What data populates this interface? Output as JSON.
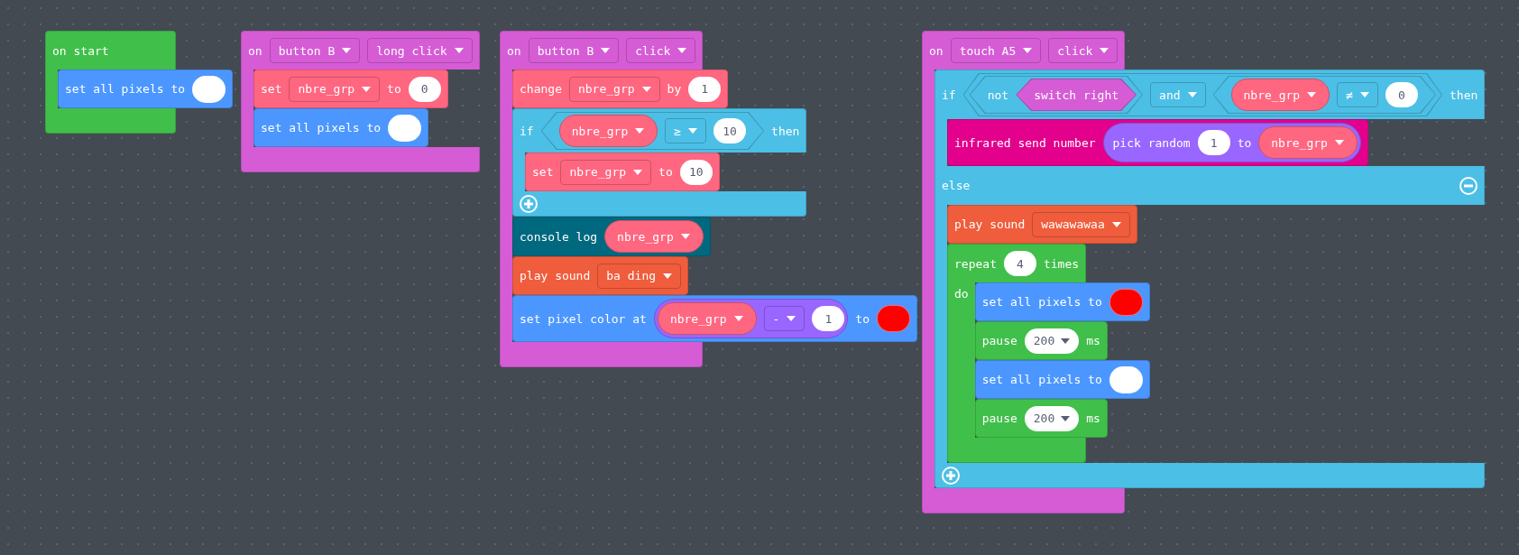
{
  "workspace": {
    "stacks": [
      {
        "kind": "hat",
        "color": "#40bf4a",
        "sections": [
          {
            "row": [
              {
                "kind": "label",
                "text": "on start"
              }
            ],
            "body": [
              {
                "kind": "statement",
                "color": "#4c97ff",
                "row": [
                  {
                    "kind": "label",
                    "text": "set all pixels to"
                  },
                  {
                    "kind": "color",
                    "color": "#ffffff"
                  }
                ]
              }
            ]
          }
        ]
      },
      {
        "kind": "hat",
        "color": "#d65cd6",
        "sections": [
          {
            "row": [
              {
                "kind": "label",
                "text": "on"
              },
              {
                "kind": "dropdown",
                "text": "button B"
              },
              {
                "kind": "dropdown",
                "text": "long click"
              }
            ],
            "body": [
              {
                "kind": "statement",
                "color": "#ff6680",
                "row": [
                  {
                    "kind": "label",
                    "text": "set"
                  },
                  {
                    "kind": "dropdown",
                    "text": "nbre_grp"
                  },
                  {
                    "kind": "label",
                    "text": "to"
                  },
                  {
                    "kind": "number",
                    "text": "0"
                  }
                ]
              },
              {
                "kind": "statement",
                "color": "#4c97ff",
                "row": [
                  {
                    "kind": "label",
                    "text": "set all pixels to"
                  },
                  {
                    "kind": "color",
                    "color": "#ffffff"
                  }
                ]
              }
            ]
          }
        ]
      },
      {
        "kind": "hat",
        "color": "#d65cd6",
        "sections": [
          {
            "row": [
              {
                "kind": "label",
                "text": "on"
              },
              {
                "kind": "dropdown",
                "text": "button B"
              },
              {
                "kind": "dropdown",
                "text": "click"
              }
            ],
            "body": [
              {
                "kind": "statement",
                "color": "#ff6680",
                "row": [
                  {
                    "kind": "label",
                    "text": "change"
                  },
                  {
                    "kind": "dropdown",
                    "text": "nbre_grp"
                  },
                  {
                    "kind": "label",
                    "text": "by"
                  },
                  {
                    "kind": "number",
                    "text": "1"
                  }
                ]
              },
              {
                "kind": "if",
                "color": "#4cbfe6",
                "sections": [
                  {
                    "row": [
                      {
                        "kind": "label",
                        "text": "if"
                      },
                      {
                        "kind": "boolean",
                        "color": "#4cbfe6",
                        "row": [
                          {
                            "kind": "variable",
                            "color": "#ff6680",
                            "text": "nbre_grp"
                          },
                          {
                            "kind": "dropdown",
                            "text": "≥"
                          },
                          {
                            "kind": "number",
                            "text": "10"
                          }
                        ]
                      },
                      {
                        "kind": "label",
                        "text": "then"
                      }
                    ],
                    "body": [
                      {
                        "kind": "statement",
                        "color": "#ff6680",
                        "row": [
                          {
                            "kind": "label",
                            "text": "set"
                          },
                          {
                            "kind": "dropdown",
                            "text": "nbre_grp"
                          },
                          {
                            "kind": "label",
                            "text": "to"
                          },
                          {
                            "kind": "number",
                            "text": "10"
                          }
                        ]
                      }
                    ]
                  }
                ],
                "footer": [
                  {
                    "kind": "plus"
                  }
                ]
              },
              {
                "kind": "statement",
                "color": "#00687f",
                "row": [
                  {
                    "kind": "label",
                    "text": "console log"
                  },
                  {
                    "kind": "variable",
                    "color": "#ff6680",
                    "text": "nbre_grp"
                  }
                ]
              },
              {
                "kind": "statement",
                "color": "#ef5d3c",
                "row": [
                  {
                    "kind": "label",
                    "text": "play sound"
                  },
                  {
                    "kind": "dropdown",
                    "text": "ba ding"
                  }
                ]
              },
              {
                "kind": "statement",
                "color": "#4c97ff",
                "row": [
                  {
                    "kind": "label",
                    "text": "set pixel color at"
                  },
                  {
                    "kind": "reporter",
                    "color": "#9966ff",
                    "row": [
                      {
                        "kind": "variable",
                        "color": "#ff6680",
                        "text": "nbre_grp"
                      },
                      {
                        "kind": "dropdown",
                        "text": "-"
                      },
                      {
                        "kind": "number",
                        "text": "1"
                      }
                    ]
                  },
                  {
                    "kind": "label",
                    "text": "to"
                  },
                  {
                    "kind": "color",
                    "color": "#ff0000"
                  }
                ]
              }
            ]
          }
        ]
      },
      {
        "kind": "hat",
        "color": "#d65cd6",
        "sections": [
          {
            "row": [
              {
                "kind": "label",
                "text": "on"
              },
              {
                "kind": "dropdown",
                "text": "touch A5"
              },
              {
                "kind": "dropdown",
                "text": "click"
              }
            ],
            "body": [
              {
                "kind": "if",
                "color": "#4cbfe6",
                "sections": [
                  {
                    "row": [
                      {
                        "kind": "label",
                        "text": "if"
                      },
                      {
                        "kind": "boolean",
                        "color": "#4cbfe6",
                        "row": [
                          {
                            "kind": "boolean",
                            "color": "#4cbfe6",
                            "row": [
                              {
                                "kind": "label",
                                "text": "not"
                              },
                              {
                                "kind": "boolean",
                                "color": "#d65cd6",
                                "row": [
                                  {
                                    "kind": "label",
                                    "text": "switch right"
                                  }
                                ]
                              }
                            ]
                          },
                          {
                            "kind": "dropdown",
                            "text": "and"
                          },
                          {
                            "kind": "boolean",
                            "color": "#4cbfe6",
                            "row": [
                              {
                                "kind": "variable",
                                "color": "#ff6680",
                                "text": "nbre_grp"
                              },
                              {
                                "kind": "dropdown",
                                "text": "≠"
                              },
                              {
                                "kind": "number",
                                "text": "0"
                              }
                            ]
                          }
                        ]
                      },
                      {
                        "kind": "label",
                        "text": "then"
                      }
                    ],
                    "body": [
                      {
                        "kind": "statement",
                        "color": "#e3008c",
                        "row": [
                          {
                            "kind": "label",
                            "text": "infrared send number"
                          },
                          {
                            "kind": "reporter",
                            "color": "#9966ff",
                            "row": [
                              {
                                "kind": "label",
                                "text": "pick random"
                              },
                              {
                                "kind": "number",
                                "text": "1"
                              },
                              {
                                "kind": "label",
                                "text": "to"
                              },
                              {
                                "kind": "variable",
                                "color": "#ff6680",
                                "text": "nbre_grp"
                              }
                            ]
                          }
                        ]
                      }
                    ]
                  },
                  {
                    "row": [
                      {
                        "kind": "label",
                        "text": "else"
                      },
                      {
                        "kind": "minus"
                      }
                    ],
                    "body": [
                      {
                        "kind": "statement",
                        "color": "#ef5d3c",
                        "row": [
                          {
                            "kind": "label",
                            "text": "play sound"
                          },
                          {
                            "kind": "dropdown",
                            "text": "wawawawaa"
                          }
                        ]
                      },
                      {
                        "kind": "repeat",
                        "color": "#40bf4a",
                        "sections": [
                          {
                            "row": [
                              {
                                "kind": "label",
                                "text": "repeat"
                              },
                              {
                                "kind": "number",
                                "text": "4"
                              },
                              {
                                "kind": "label",
                                "text": "times"
                              }
                            ],
                            "arm": [
                              {
                                "kind": "label",
                                "text": "do"
                              }
                            ],
                            "body": [
                              {
                                "kind": "statement",
                                "color": "#4c97ff",
                                "row": [
                                  {
                                    "kind": "label",
                                    "text": "set all pixels to"
                                  },
                                  {
                                    "kind": "color",
                                    "color": "#ff0000"
                                  }
                                ]
                              },
                              {
                                "kind": "statement",
                                "color": "#40bf4a",
                                "row": [
                                  {
                                    "kind": "label",
                                    "text": "pause"
                                  },
                                  {
                                    "kind": "number-dropdown",
                                    "text": "200"
                                  },
                                  {
                                    "kind": "label",
                                    "text": "ms"
                                  }
                                ]
                              },
                              {
                                "kind": "statement",
                                "color": "#4c97ff",
                                "row": [
                                  {
                                    "kind": "label",
                                    "text": "set all pixels to"
                                  },
                                  {
                                    "kind": "color",
                                    "color": "#ffffff"
                                  }
                                ]
                              },
                              {
                                "kind": "statement",
                                "color": "#40bf4a",
                                "row": [
                                  {
                                    "kind": "label",
                                    "text": "pause"
                                  },
                                  {
                                    "kind": "number-dropdown",
                                    "text": "200"
                                  },
                                  {
                                    "kind": "label",
                                    "text": "ms"
                                  }
                                ]
                              }
                            ]
                          }
                        ]
                      }
                    ]
                  }
                ],
                "footer": [
                  {
                    "kind": "plus"
                  }
                ]
              }
            ]
          }
        ]
      }
    ]
  }
}
